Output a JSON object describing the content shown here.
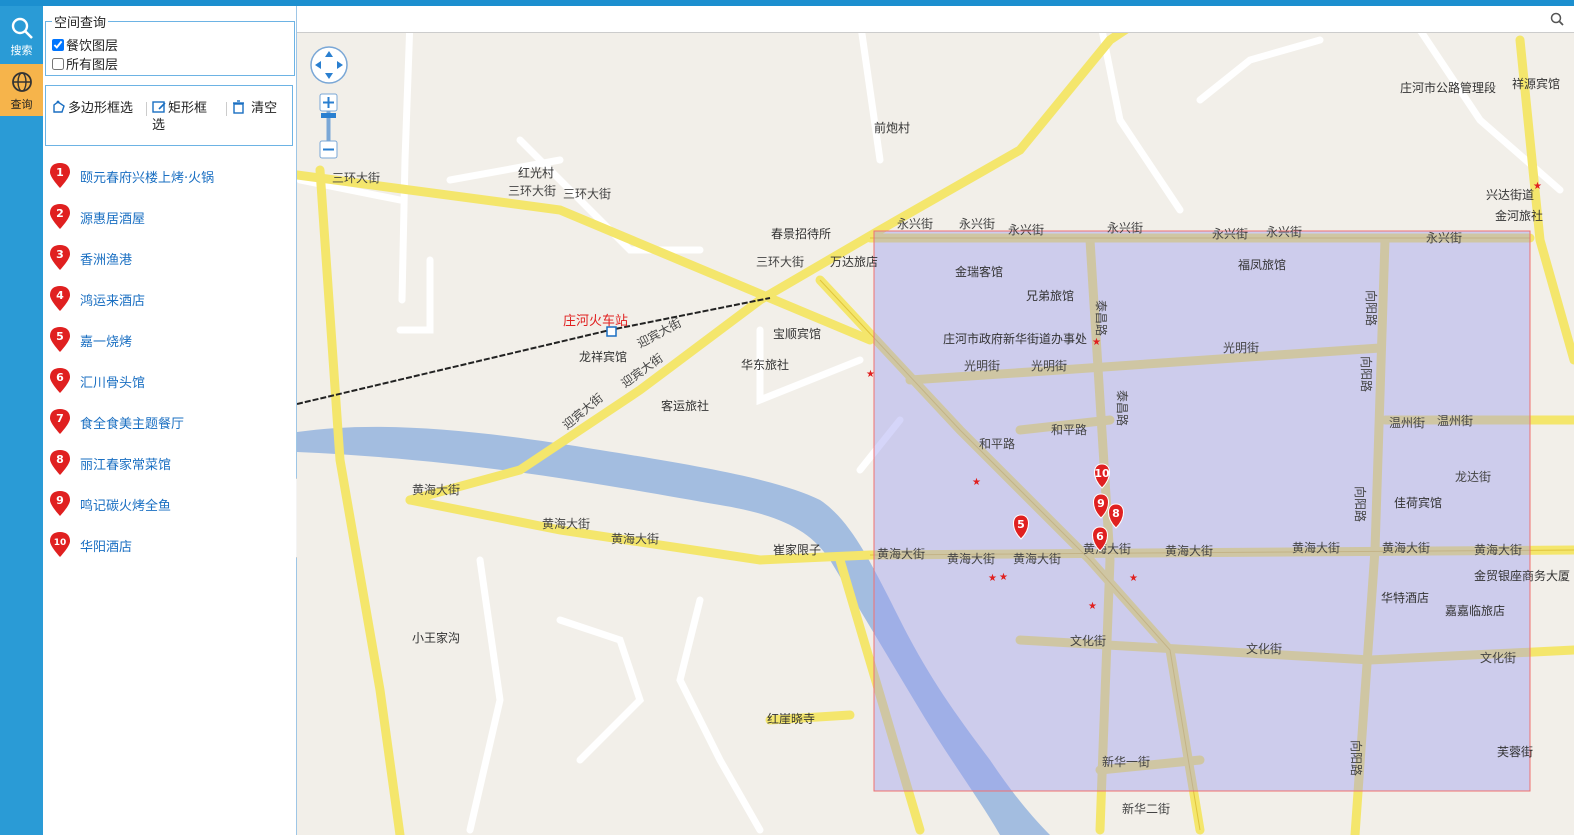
{
  "nav": {
    "search_label": "搜索",
    "query_label": "查询"
  },
  "spatial": {
    "legend": "空间查询",
    "layers": [
      {
        "label": "餐饮图层",
        "checked": true
      },
      {
        "label": "所有图层",
        "checked": false
      }
    ]
  },
  "tools": {
    "polygon": "多边形框选",
    "rect_line1": "矩形框",
    "rect_line2": "选",
    "clear": "清空"
  },
  "results": [
    {
      "n": "1",
      "name": "颐元春府兴楼上烤·火锅"
    },
    {
      "n": "2",
      "name": "源惠居酒屋"
    },
    {
      "n": "3",
      "name": "香洲渔港"
    },
    {
      "n": "4",
      "name": "鸿运来酒店"
    },
    {
      "n": "5",
      "name": "嘉一烧烤"
    },
    {
      "n": "6",
      "name": "汇川骨头馆"
    },
    {
      "n": "7",
      "name": "食全食美主题餐厅"
    },
    {
      "n": "8",
      "name": "丽江春家常菜馆"
    },
    {
      "n": "9",
      "name": "鸣记碳火烤全鱼"
    },
    {
      "n": "10",
      "name": "华阳酒店"
    }
  ],
  "map": {
    "station": "庄河火车站",
    "labels": {
      "qianpaocun": "前炮村",
      "hongguangcun": "红光村",
      "sanhuan1": "三环大街",
      "sanhuan2": "三环大街",
      "sanhuan3": "三环大街",
      "sanhuan4": "三环大街",
      "chunjing": "春景招待所",
      "wanda": "万达旅店",
      "baoshun": "宝顺宾馆",
      "longxiang": "龙祥宾馆",
      "huadong": "华东旅社",
      "keyun": "客运旅社",
      "yongxing1": "永兴街",
      "yongxing2": "永兴街",
      "yongxing3": "永兴街",
      "yongxing4": "永兴街",
      "yongxing5": "永兴街",
      "yongxing6": "永兴街",
      "yongxing7": "永兴街",
      "jinrui": "金瑞客馆",
      "xiongdi": "兄弟旅馆",
      "fufeng": "福凤旅馆",
      "banshichu": "庄河市政府新华街道办事处",
      "guangming1": "光明街",
      "guangming2": "光明街",
      "guangming3": "光明街",
      "heping1": "和平路",
      "heping2": "和平路",
      "huanghai1": "黄海大街",
      "huanghai2": "黄海大街",
      "huanghai3": "黄海大街",
      "huanghai4": "黄海大街",
      "huanghai5": "黄海大街",
      "huanghai6": "黄海大街",
      "huanghai7": "黄海大街",
      "huanghai8": "黄海大街",
      "huanghai9": "黄海大街",
      "huanghai10": "黄海大街",
      "huanghai11": "黄海大街",
      "cuijia": "崔家限子",
      "xiaowang": "小王家沟",
      "hongya": "红崖晓寺",
      "wenhua1": "文化街",
      "wenhua2": "文化街",
      "wenhua3": "文化街",
      "xinhua1": "新华一街",
      "xinhua2": "新华二街",
      "wenzhou1": "温州街",
      "wenzhou2": "温州街",
      "longda": "龙达街",
      "jiahe": "佳荷宾馆",
      "jinmao": "金贸银座商务大厦",
      "huate": "华特酒店",
      "jiajia": "嘉嘉临旅店",
      "gonglu": "庄河市公路管理段",
      "xiangyuan": "祥源宾馆",
      "xingda": "兴达街道",
      "jinhe": "金河旅社",
      "furong": "芙蓉街",
      "yingbin1": "迎宾大街",
      "yingbin2": "迎宾大街",
      "yingbin3": "迎宾大街",
      "taichang1": "泰昌路",
      "taichang2": "泰昌路",
      "xiangyang1": "向阳路",
      "xiangyang2": "向阳路",
      "xiangyang3": "向阳路",
      "xiangyang4": "向阳路"
    },
    "markers": [
      "10",
      "9",
      "8",
      "5",
      "6"
    ]
  },
  "colors": {
    "nav": "#2a9bd6",
    "nav_active": "#f6b44b",
    "link": "#1a6fc2",
    "pin": "#e02020",
    "selection": "#9b9bf0"
  }
}
